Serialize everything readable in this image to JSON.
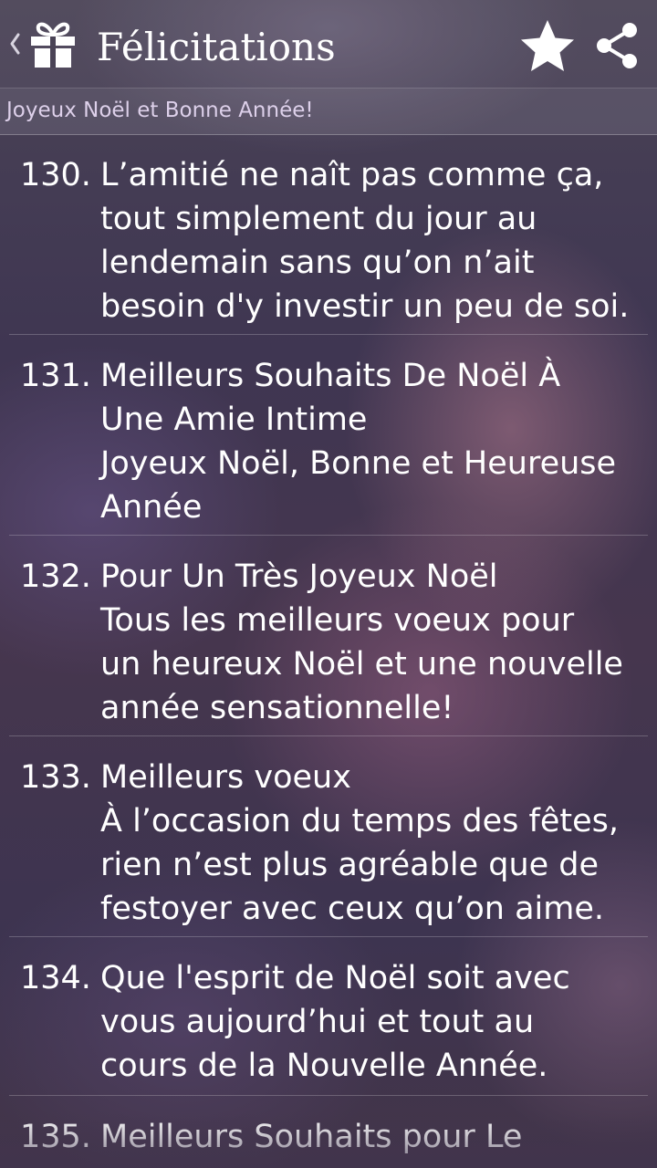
{
  "header": {
    "title": "Félicitations",
    "icons": {
      "back": "chevron-left-icon",
      "app": "gift-icon",
      "favorite": "star-icon",
      "share": "share-icon"
    }
  },
  "subtitle": "Joyeux Noël et Bonne Année!",
  "items": [
    {
      "number": "130.",
      "lines": [
        "L’amitié ne naît pas comme ça,",
        "tout simplement du jour au",
        "lendemain sans qu’on n’ait",
        "besoin d'y investir un peu de soi."
      ]
    },
    {
      "number": "131.",
      "lines": [
        "Meilleurs Souhaits De Noël À",
        "Une Amie Intime",
        "Joyeux Noël, Bonne et Heureuse",
        "Année"
      ]
    },
    {
      "number": "132.",
      "lines": [
        "Pour Un Très Joyeux Noël",
        "Tous les meilleurs voeux pour",
        "un heureux Noël et une nouvelle",
        "année sensationnelle!"
      ]
    },
    {
      "number": "133.",
      "lines": [
        "Meilleurs voeux",
        "À l’occasion du temps des fêtes,",
        "rien n’est plus agréable que de",
        "festoyer avec ceux qu’on aime."
      ]
    },
    {
      "number": "134.",
      "lines": [
        "Que l'esprit de Noël soit avec",
        "vous aujourd’hui et tout au",
        "cours de la Nouvelle Année."
      ]
    },
    {
      "number": "135.",
      "lines": [
        "Meilleurs Souhaits pour Le"
      ]
    }
  ]
}
